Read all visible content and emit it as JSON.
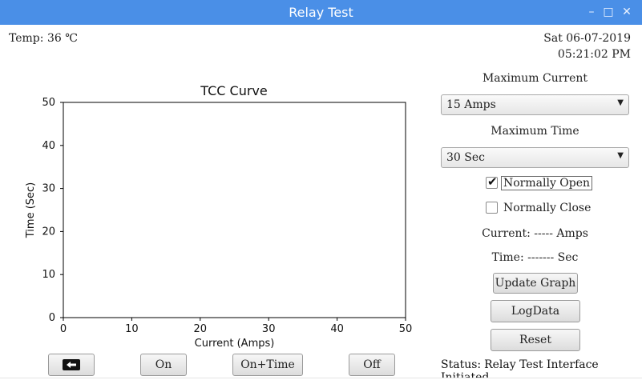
{
  "window": {
    "title": "Relay Test"
  },
  "header": {
    "temp": "Temp: 36 ℃",
    "date": "Sat 06-07-2019",
    "time": "05:21:02 PM"
  },
  "chart_data": {
    "type": "line",
    "title": "TCC Curve",
    "xlabel": "Current (Amps)",
    "ylabel": "Time (Sec)",
    "xlim": [
      0,
      50
    ],
    "ylim": [
      0,
      50
    ],
    "x_ticks": [
      "0",
      "10",
      "20",
      "30",
      "40",
      "50"
    ],
    "y_ticks": [
      "0",
      "10",
      "20",
      "30",
      "40",
      "50"
    ],
    "series": [],
    "grid": false
  },
  "controls": {
    "max_current_label": "Maximum Current",
    "max_current_value": "15 Amps",
    "max_time_label": "Maximum Time",
    "max_time_value": "30 Sec",
    "normally_open_label": "Normally Open",
    "normally_open_checked": true,
    "normally_close_label": "Normally Close",
    "normally_close_checked": false,
    "current_readout": "Current: ----- Amps",
    "time_readout": "Time: ------- Sec",
    "update_graph": "Update Graph",
    "log_data": "LogData",
    "reset": "Reset"
  },
  "bottom_buttons": {
    "back_icon": "arrow-left-icon",
    "on": "On",
    "on_time": "On+Time",
    "off": "Off"
  },
  "status": {
    "label": "Status:",
    "text": "Relay Test Interface Initiated"
  },
  "colors": {
    "titlebar": "#4a8fe7"
  }
}
